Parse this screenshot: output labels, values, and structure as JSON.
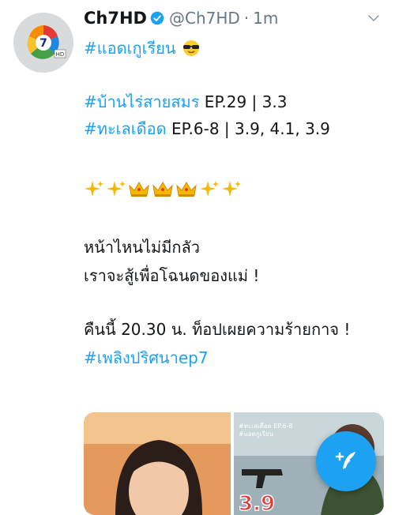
{
  "tweet": {
    "display_name": "Ch7HD",
    "handle": "@Ch7HD",
    "separator": "·",
    "time": "1m",
    "lines": {
      "l1_tag": "#แอดเกูเรียน",
      "l2_tag": "#บ้านไร่สายสมร",
      "l2_text": " EP.29 | 3.3",
      "l3_tag": "#ทะเลเดือด",
      "l3_text": " EP.6-8 | 3.9, 4.1, 3.9",
      "l4": "หน้าไหนไม่มีกลัว",
      "l5": "เราจะสู้เพื่อโฉนดของแม่ !",
      "l6": "คืนนี้ 20.30 น. ท็อปเผยความร้ายกาจ !",
      "l7_tag": "#เพลิงปริศนาep7"
    },
    "media_overlay": {
      "caption_top": "#ทะเลเดือด EP.6-8",
      "caption_tag": "#แอดกูเรียน",
      "rating": "3.9"
    }
  },
  "colors": {
    "link": "#1da1f2",
    "text": "#14171a",
    "muted": "#657786",
    "accent": "#1da1f2"
  },
  "icons": [
    "verified-badge-icon",
    "chevron-down-icon",
    "sunglasses-emoji",
    "sparkles-emoji",
    "crown-emoji",
    "compose-tweet-icon"
  ]
}
